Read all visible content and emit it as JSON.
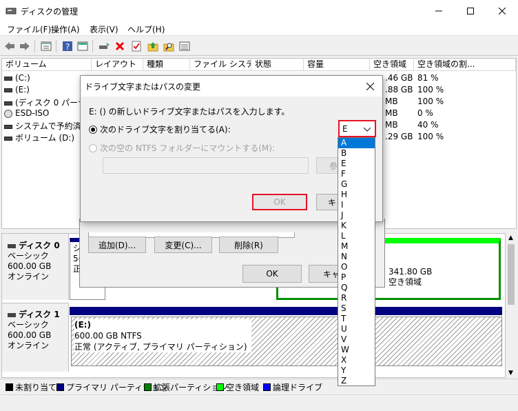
{
  "window": {
    "title": "ディスクの管理"
  },
  "menu": [
    "ファイル(F)",
    "操作(A)",
    "表示(V)",
    "ヘルプ(H)"
  ],
  "columns": [
    "ボリューム",
    "レイアウト",
    "種類",
    "ファイル システム",
    "状態",
    "容量",
    "空き領域",
    "空き領域の割..."
  ],
  "volumes": [
    {
      "name": "(C:)",
      "free": ".46 GB",
      "pct": "81 %"
    },
    {
      "name": "(E:)",
      "free": ".88 GB",
      "pct": "100 %"
    },
    {
      "name": "(ディスク 0 パーティシ",
      "free": "MB",
      "pct": "100 %"
    },
    {
      "name": "ESD-ISO",
      "free": "MB",
      "pct": "0 %"
    },
    {
      "name": "システムで予約済み",
      "free": "MB",
      "pct": "40 %"
    },
    {
      "name": "ボリューム (D:)",
      "free": ".29 GB",
      "pct": "100 %"
    }
  ],
  "disk0": {
    "name": "ディスク 0",
    "type": "ベーシック",
    "size": "600.00 GB",
    "status": "オンライン",
    "cut1": "シ",
    "cut2": "5(",
    "cut3": "正",
    "unalloc_size": "341.80 GB",
    "unalloc_label": "空き領域"
  },
  "disk1": {
    "name": "ディスク 1",
    "type": "ベーシック",
    "size": "600.00 GB",
    "status": "オンライン",
    "vol": "(E:)",
    "vol_size": "600.00 GB NTFS",
    "vol_status": "正常 (アクティブ, プライマリ パーティション)"
  },
  "legend": [
    "未割り当て",
    "プライマリ パーティション",
    "拡張パーティション",
    "空き領域",
    "論理ドライブ"
  ],
  "legend_colors": [
    "#000000",
    "#000080",
    "#008000",
    "#00ff00",
    "#0000ff"
  ],
  "parent_dialog": {
    "add": "追加(D)...",
    "change": "変更(C)...",
    "remove": "削除(R)",
    "ok": "OK",
    "cancel": "キャ"
  },
  "dialog": {
    "title": "ドライブ文字またはパスの変更",
    "instruction": "E: () の新しいドライブ文字またはパスを入力します。",
    "radio1": "次のドライブ文字を割り当てる(A):",
    "radio2": "次の空の NTFS フォルダーにマウントする(M):",
    "selected_letter": "E",
    "browse": "参",
    "ok": "OK",
    "cancel": "キャ"
  },
  "letters": [
    "A",
    "B",
    "E",
    "F",
    "G",
    "H",
    "I",
    "J",
    "K",
    "L",
    "M",
    "N",
    "O",
    "P",
    "Q",
    "R",
    "S",
    "T",
    "U",
    "V",
    "W",
    "X",
    "Y",
    "Z"
  ],
  "highlighted_letter": "A",
  "colors": {
    "accent": "#0078d7",
    "focus_red": "#e81123",
    "primary_bar": "#000080",
    "free_green": "#00ff00"
  }
}
